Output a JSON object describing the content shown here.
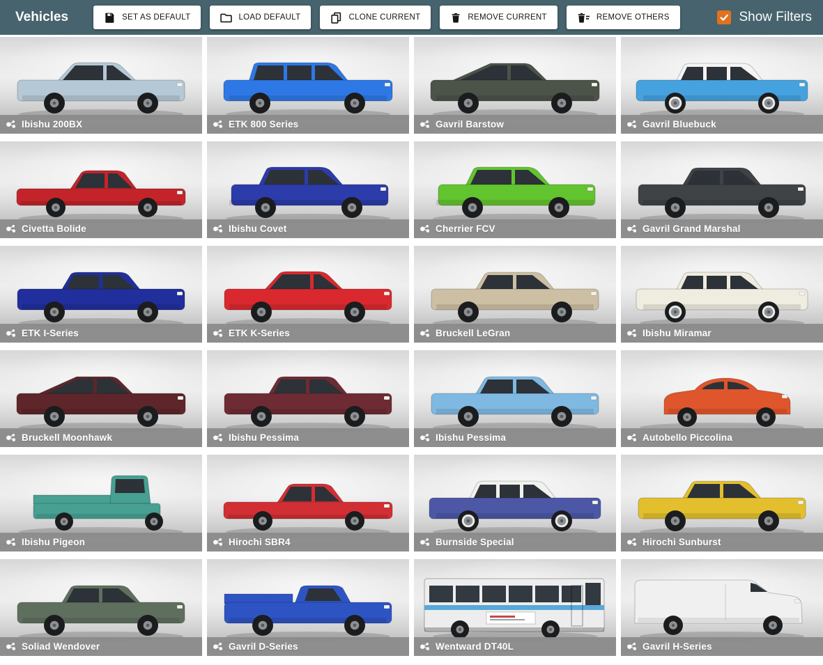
{
  "header": {
    "title": "Vehicles",
    "buttons": [
      {
        "label": "SET AS DEFAULT",
        "icon": "save-icon"
      },
      {
        "label": "LOAD DEFAULT",
        "icon": "folder-icon"
      },
      {
        "label": "CLONE CURRENT",
        "icon": "clone-icon"
      },
      {
        "label": "REMOVE CURRENT",
        "icon": "trash-icon"
      },
      {
        "label": "REMOVE OTHERS",
        "icon": "trash-list-icon"
      }
    ],
    "filter_toggle": {
      "label": "Show Filters",
      "checked": true
    }
  },
  "colors": {
    "header_bg": "#47646e",
    "accent_orange": "#e2711d",
    "caption_bg": "#8a8a8a",
    "caption_text": "#ffffff",
    "button_bg": "#ffffff",
    "button_text": "#151515"
  },
  "card_icon": "vehicle-icon",
  "vehicles": [
    {
      "name": "Ibishu 200BX",
      "type": "coupe",
      "body": "#b5c8d6"
    },
    {
      "name": "ETK 800 Series",
      "type": "wagon",
      "body": "#2e78e6"
    },
    {
      "name": "Gavril Barstow",
      "type": "fastback",
      "body": "#4c5349"
    },
    {
      "name": "Gavril Bluebuck",
      "type": "classic",
      "body": "#46a2df",
      "roof": "#f4f4f4"
    },
    {
      "name": "Civetta Bolide",
      "type": "sports",
      "body": "#c3242a"
    },
    {
      "name": "Ibishu Covet",
      "type": "hatch",
      "body": "#2c3cab"
    },
    {
      "name": "Cherrier FCV",
      "type": "hatch",
      "body": "#62c42e"
    },
    {
      "name": "Gavril Grand Marshal",
      "type": "sedan",
      "body": "#3f4346"
    },
    {
      "name": "ETK I-Series",
      "type": "sedan",
      "body": "#202f9c"
    },
    {
      "name": "ETK K-Series",
      "type": "coupe",
      "body": "#d9292e"
    },
    {
      "name": "Bruckell LeGran",
      "type": "sedan",
      "body": "#cdbfa3"
    },
    {
      "name": "Ibishu Miramar",
      "type": "classic",
      "body": "#efece0",
      "roof": "#efece0"
    },
    {
      "name": "Bruckell Moonhawk",
      "type": "fastback",
      "body": "#5e262b"
    },
    {
      "name": "Ibishu Pessima",
      "type": "sedan",
      "body": "#6f2b34"
    },
    {
      "name": "Ibishu Pessima",
      "type": "sedan",
      "body": "#7fb9e2"
    },
    {
      "name": "Autobello Piccolina",
      "type": "small",
      "body": "#df552c"
    },
    {
      "name": "Ibishu Pigeon",
      "type": "pigeon",
      "body": "#47a092"
    },
    {
      "name": "Hirochi SBR4",
      "type": "sports",
      "body": "#d22f34"
    },
    {
      "name": "Burnside Special",
      "type": "classic",
      "body": "#4c57a6",
      "roof": "#f1f1ee"
    },
    {
      "name": "Hirochi Sunburst",
      "type": "sedan",
      "body": "#e3bf2d"
    },
    {
      "name": "Soliad Wendover",
      "type": "sedan",
      "body": "#5f6f5e"
    },
    {
      "name": "Gavril D-Series",
      "type": "pickup",
      "body": "#2e54c4"
    },
    {
      "name": "Wentward DT40L",
      "type": "bus",
      "body": "#ededed",
      "stripe": "#58a8d8"
    },
    {
      "name": "Gavril H-Series",
      "type": "van",
      "body": "#f0f0f0"
    }
  ]
}
